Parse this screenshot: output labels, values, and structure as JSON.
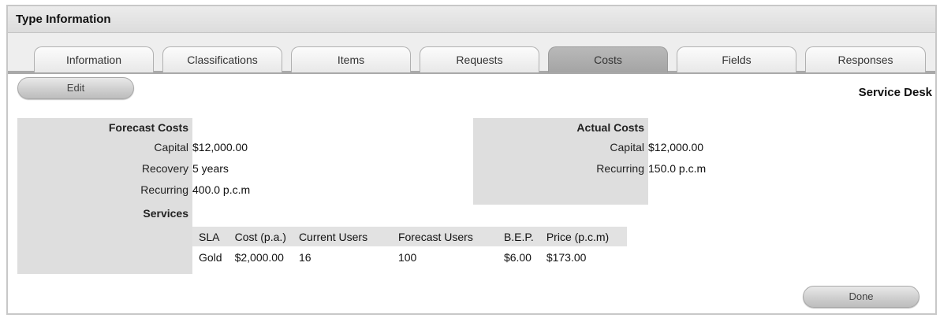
{
  "window": {
    "title": "Type Information"
  },
  "tabs": [
    {
      "label": "Information",
      "active": false
    },
    {
      "label": "Classifications",
      "active": false
    },
    {
      "label": "Items",
      "active": false
    },
    {
      "label": "Requests",
      "active": false
    },
    {
      "label": "Costs",
      "active": true
    },
    {
      "label": "Fields",
      "active": false
    },
    {
      "label": "Responses",
      "active": false
    }
  ],
  "toolbar": {
    "edit_label": "Edit",
    "context": "Service Desk"
  },
  "forecast": {
    "heading": "Forecast Costs",
    "capital_label": "Capital",
    "capital_value": "$12,000.00",
    "recovery_label": "Recovery",
    "recovery_value": "5 years",
    "recurring_label": "Recurring",
    "recurring_value": "400.0 p.c.m"
  },
  "actual": {
    "heading": "Actual Costs",
    "capital_label": "Capital",
    "capital_value": "$12,000.00",
    "recurring_label": "Recurring",
    "recurring_value": "150.0 p.c.m"
  },
  "services": {
    "heading": "Services",
    "columns": [
      "SLA",
      "Cost (p.a.)",
      "Current Users",
      "Forecast Users",
      "B.E.P.",
      "Price (p.c.m)"
    ],
    "rows": [
      [
        "Gold",
        "$2,000.00",
        "16",
        "100",
        "$6.00",
        "$173.00"
      ]
    ]
  },
  "footer": {
    "done_label": "Done"
  },
  "colors": {
    "label_bg": "#dedede",
    "active_tab": "#a9a9a9",
    "title_bar": "#e4e4e4"
  }
}
